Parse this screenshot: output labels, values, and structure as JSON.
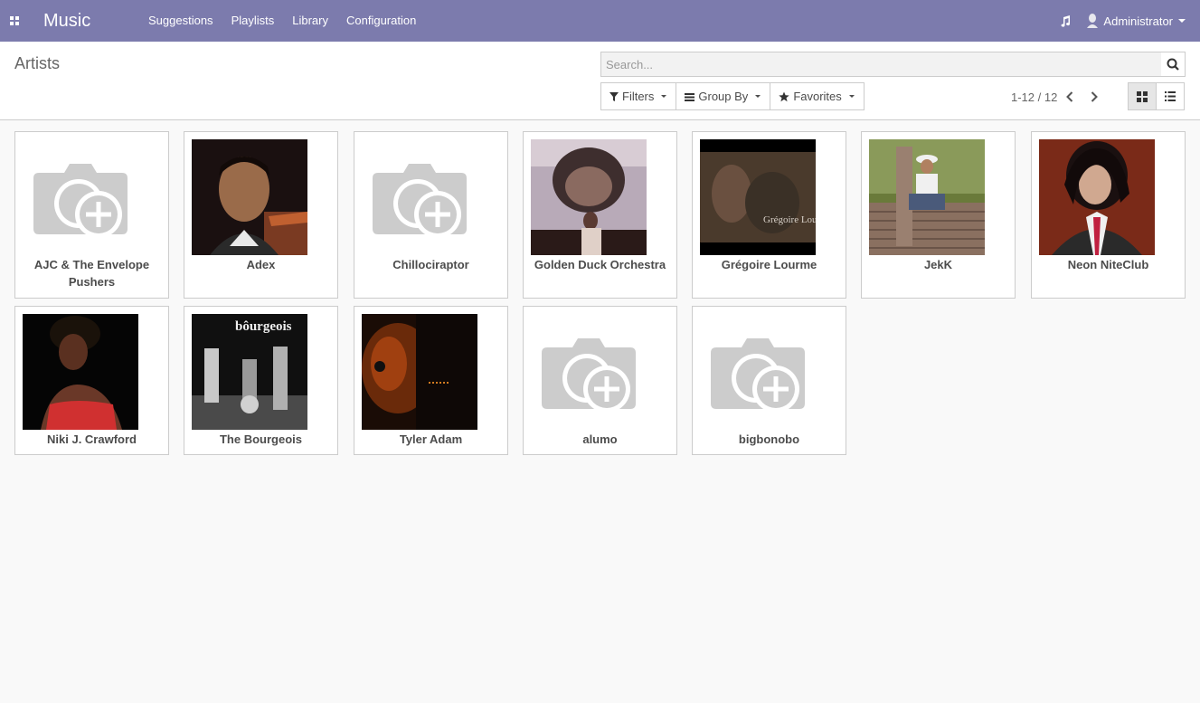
{
  "navbar": {
    "brand": "Music",
    "menu": [
      "Suggestions",
      "Playlists",
      "Library",
      "Configuration"
    ],
    "user": "Administrator"
  },
  "control_panel": {
    "breadcrumb": "Artists",
    "search_placeholder": "Search...",
    "filters_label": "Filters",
    "groupby_label": "Group By",
    "favorites_label": "Favorites",
    "pager": "1-12 / 12"
  },
  "artists": [
    {
      "name": "AJC & The Envelope Pushers",
      "image": "placeholder"
    },
    {
      "name": "Adex",
      "image": "photo"
    },
    {
      "name": "Chillociraptor",
      "image": "placeholder"
    },
    {
      "name": "Golden Duck Orchestra",
      "image": "photo"
    },
    {
      "name": "Grégoire Lourme",
      "image": "photo"
    },
    {
      "name": "JekK",
      "image": "photo"
    },
    {
      "name": "Neon NiteClub",
      "image": "photo"
    },
    {
      "name": "Niki J. Crawford",
      "image": "photo"
    },
    {
      "name": "The Bourgeois",
      "image": "photo"
    },
    {
      "name": "Tyler Adam",
      "image": "photo"
    },
    {
      "name": "alumo",
      "image": "placeholder"
    },
    {
      "name": "bigbonobo",
      "image": "placeholder"
    }
  ],
  "photo_labels": {
    "bourgeois": "bôurgeois",
    "gregoire": "Grégoire Lourm"
  },
  "colors": {
    "navbar": "#7c7bad",
    "background": "#f9f9f9"
  }
}
